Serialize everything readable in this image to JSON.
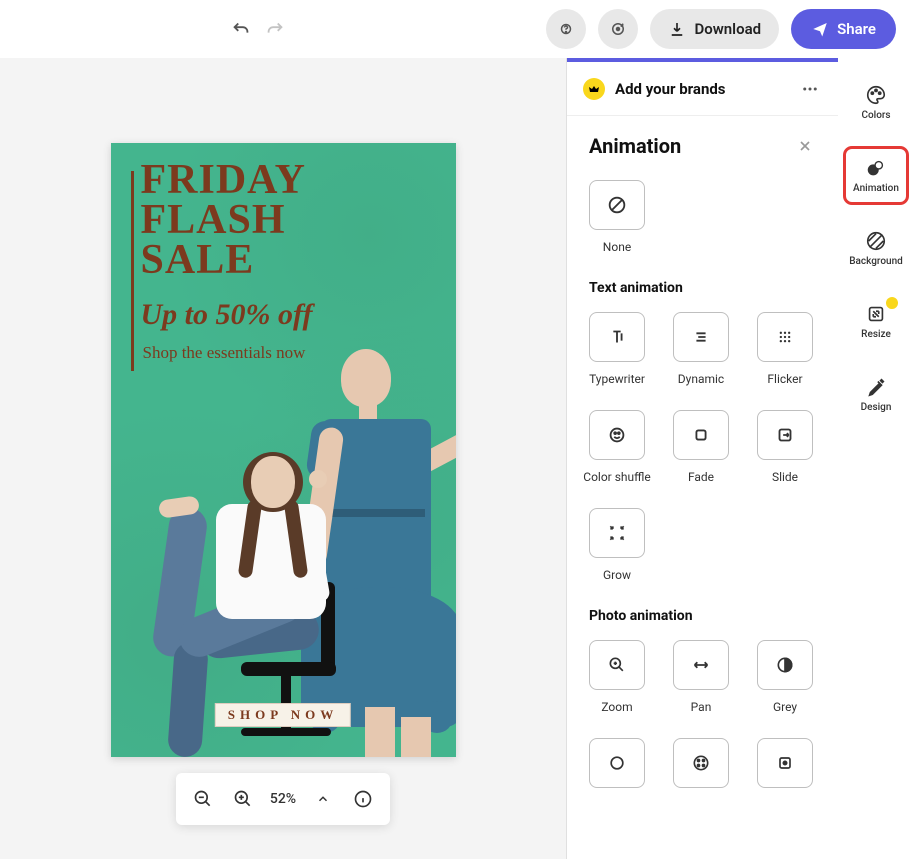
{
  "topbar": {
    "download_label": "Download",
    "share_label": "Share"
  },
  "canvas": {
    "headline_l1": "FRIDAY",
    "headline_l2": "FLASH",
    "headline_l3": "SALE",
    "subhead": "Up to 50% off",
    "tagline": "Shop the essentials now",
    "cta": "SHOP NOW"
  },
  "zoom": {
    "level": "52%"
  },
  "brands": {
    "title": "Add your brands"
  },
  "panel": {
    "title": "Animation",
    "none_label": "None",
    "text_section": "Text animation",
    "photo_section": "Photo animation",
    "text_items": [
      "Typewriter",
      "Dynamic",
      "Flicker",
      "Color shuffle",
      "Fade",
      "Slide",
      "Grow"
    ],
    "photo_items": [
      "Zoom",
      "Pan",
      "Grey"
    ]
  },
  "rail": {
    "colors": "Colors",
    "animation": "Animation",
    "background": "Background",
    "resize": "Resize",
    "design": "Design"
  }
}
